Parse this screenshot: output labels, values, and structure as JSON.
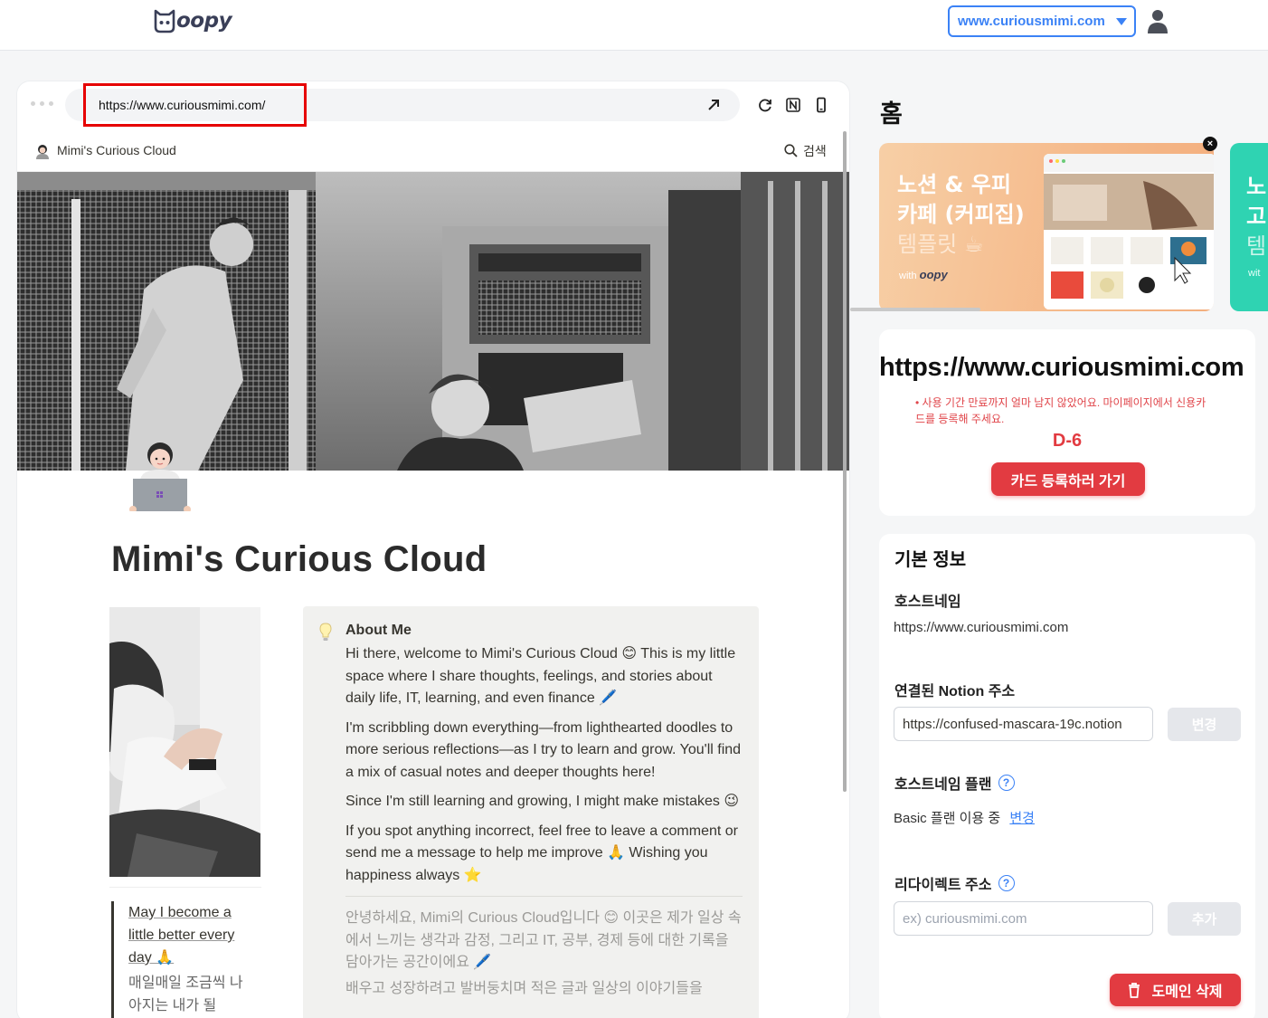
{
  "header": {
    "logo_text": "oopy",
    "domain_selected": "www.curiousmimi.com"
  },
  "preview": {
    "url": "https://www.curiousmimi.com/",
    "site_title": "Mimi's Curious Cloud",
    "search_label": "검색",
    "page_title": "Mimi's Curious Cloud",
    "quote": {
      "en": "May I become a little better every day 🙏",
      "ko": "매일매일 조금씩 나아지는 내가 될"
    },
    "callout": {
      "heading": "About Me",
      "p1": "Hi there, welcome to Mimi's Curious Cloud 😊 This is my little space where I share thoughts, feelings, and stories about daily life, IT, learning, and even finance 🖊️",
      "p2": "I'm scribbling down everything—from lighthearted doodles to more serious reflections—as I try to learn and grow. You'll find a mix of casual notes and deeper thoughts here!",
      "p3": "Since I'm still learning and growing, I might make mistakes 😉",
      "p4": "If you spot anything incorrect, feel free to leave a comment or send me a message to help me improve 🙏 Wishing you happiness always ⭐",
      "ko1": "안녕하세요, Mimi의 Curious Cloud입니다 😊 이곳은 제가 일상 속에서 느끼는 생각과 감정, 그리고 IT, 공부, 경제 등에 대한 기록을 담아가는 공간이에요 🖊️",
      "ko2": "배우고 성장하려고 발버둥치며 적은 글과 일상의 이야기들을"
    }
  },
  "panel": {
    "home_title": "홈",
    "banner": {
      "line1": "노션 & 우피",
      "line2": "카페 (커피집)",
      "line3": "템플릿 ☕",
      "with": "with",
      "logo": "oopy"
    },
    "banner2": {
      "line1": "노",
      "line2": "고",
      "line3": "템",
      "with": "wit"
    },
    "plan": {
      "hostname": "https://www.curiousmimi.com",
      "warning": "• 사용 기간 만료까지 얼마 남지 않았어요. 마이페이지에서 신용카드를 등록해 주세요.",
      "dday": "D-6",
      "button": "카드 등록하러 가기"
    },
    "info": {
      "title": "기본 정보",
      "hostname_label": "호스트네임",
      "hostname_value": "https://www.curiousmimi.com",
      "notion_label": "연결된 Notion 주소",
      "notion_value": "https://confused-mascara-19c.notion",
      "change_button": "변경",
      "plan_label": "호스트네임 플랜",
      "plan_value": "Basic 플랜 이용 중",
      "plan_change_link": "변경",
      "redirect_label": "리다이렉트 주소",
      "redirect_placeholder": "ex) curiousmimi.com",
      "add_button": "추가",
      "delete_button": "도메인 삭제",
      "help_glyph": "?"
    },
    "close_glyph": "×"
  },
  "colors": {
    "accent_blue": "#3b82f6",
    "danger_red": "#e23b41",
    "banner_orange": "#f5b98a",
    "banner_teal": "#2fd3b2"
  },
  "icons": [
    "oopy-logo-icon",
    "chevron-down-icon",
    "user-icon",
    "external-link-icon",
    "refresh-icon",
    "notion-icon",
    "mobile-icon",
    "search-icon",
    "lightbulb-icon",
    "close-icon",
    "help-icon",
    "trash-icon"
  ]
}
